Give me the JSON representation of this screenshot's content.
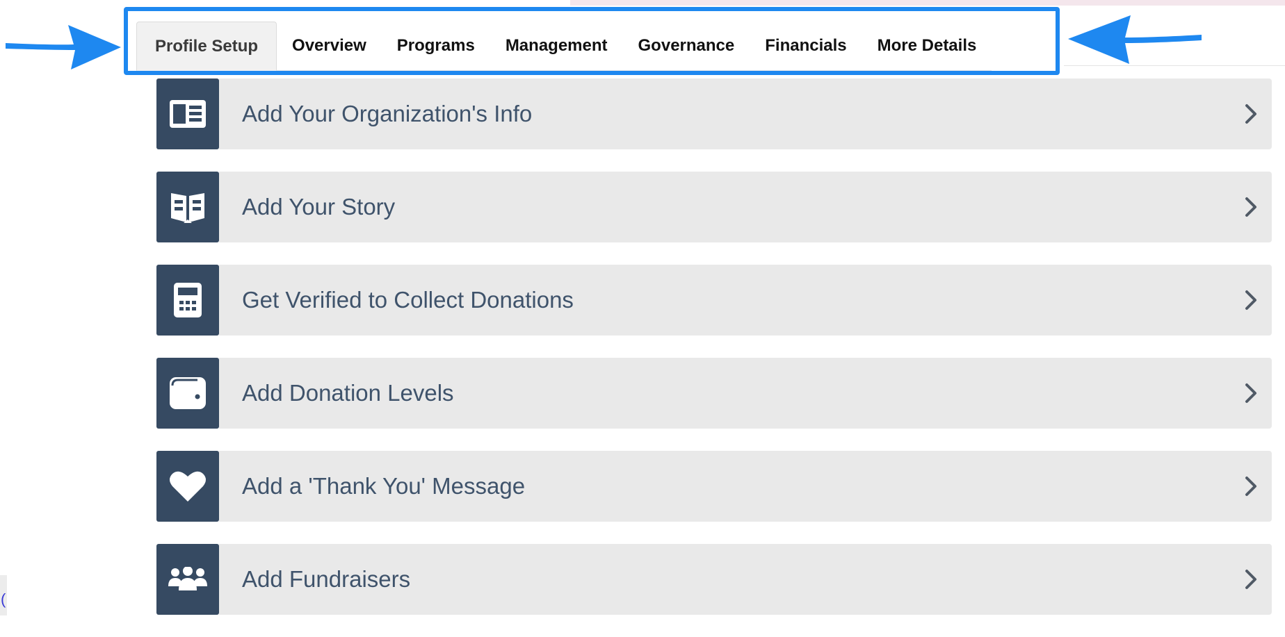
{
  "tabs": [
    {
      "label": "Profile Setup",
      "active": true
    },
    {
      "label": "Overview",
      "active": false
    },
    {
      "label": "Programs",
      "active": false
    },
    {
      "label": "Management",
      "active": false
    },
    {
      "label": "Governance",
      "active": false
    },
    {
      "label": "Financials",
      "active": false
    },
    {
      "label": "More Details",
      "active": false
    }
  ],
  "setup_items": [
    {
      "label": "Add Your Organization's Info",
      "icon": "id-card-icon"
    },
    {
      "label": "Add Your Story",
      "icon": "open-book-icon"
    },
    {
      "label": "Get Verified to Collect Donations",
      "icon": "calculator-icon"
    },
    {
      "label": "Add Donation Levels",
      "icon": "wallet-icon"
    },
    {
      "label": "Add a 'Thank You' Message",
      "icon": "heart-icon"
    },
    {
      "label": "Add Fundraisers",
      "icon": "people-group-icon"
    }
  ],
  "corner_text": "(",
  "colors": {
    "highlight_frame": "#1e88f0",
    "icon_tile": "#364a62",
    "row_background": "#e9e9e9",
    "row_text": "#3f536b",
    "annotation_arrow": "#1e88f0"
  }
}
